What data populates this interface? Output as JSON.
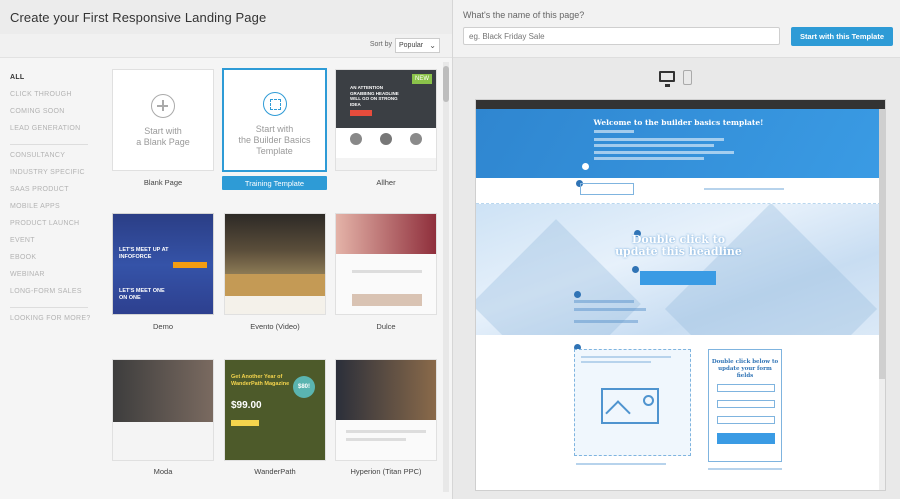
{
  "left_panel": {
    "title": "Create your First Responsive Landing Page",
    "sort_by_label": "Sort by",
    "sort_selected": "Popular",
    "categories": [
      "ALL",
      "CLICK THROUGH",
      "COMING SOON",
      "LEAD GENERATION",
      "CONSULTANCY",
      "INDUSTRY SPECIFIC",
      "SAAS PRODUCT",
      "MOBILE APPS",
      "PRODUCT LAUNCH",
      "EVENT",
      "EBOOK",
      "WEBINAR",
      "LONG-FORM SALES",
      "LOOKING FOR MORE?"
    ],
    "blank_card_text": "Start with\na Blank Page",
    "training_card_text": "Start with\nthe Builder Basics\nTemplate",
    "templates": [
      "Blank Page",
      "Training Template",
      "Allher",
      "Demo",
      "Evento (Video)",
      "Dulce",
      "Moda",
      "WanderPath",
      "Hyperion (Titan PPC)"
    ],
    "new_badge": "NEW"
  },
  "right_panel": {
    "question": "What's the name of this page?",
    "input_placeholder": "eg. Black Friday Sale",
    "start_button": "Start with this Template",
    "preview": {
      "hero_title": "Welcome to the builder basics template!",
      "headline": "Double click to\nupdate this headline",
      "form_title": "Double click below to\nupdate your form fields"
    }
  },
  "colors": {
    "accent": "#2e9bd6",
    "preview_blue": "#2f86d0",
    "dark": "#333333"
  },
  "thumbnails": {
    "allher_headline": "AN ATTENTION GRABBING HEADLINE WILL GO ON STRONG IDEA",
    "demo_headline_1": "LET'S MEET UP AT INFOFORCE",
    "demo_headline_2": "LET'S MEET ONE ON ONE",
    "wanderpath_headline": "Get Another Year of WanderPath Magazine",
    "wanderpath_price": "$99.00",
    "wanderpath_badge": "$80!"
  }
}
